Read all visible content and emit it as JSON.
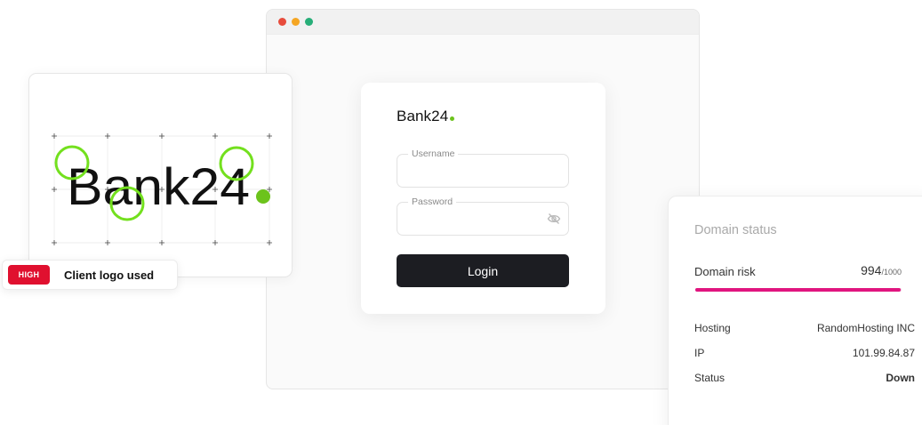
{
  "colors": {
    "dot_red": "#e74c3c",
    "dot_yellow": "#f5a623",
    "dot_green": "#27ae78",
    "brand_accent": "#6cc31c",
    "highlight_circle": "#73e01e",
    "severity_high": "#e0102f",
    "risk_bar": "#e0157f"
  },
  "browser": {
    "window_controls": [
      "close-dot",
      "minimize-dot",
      "maximize-dot"
    ]
  },
  "login": {
    "brand": "Bank24",
    "username_label": "Username",
    "username_value": "",
    "password_label": "Password",
    "password_value": "",
    "password_icon": "eye-off-icon",
    "login_button": "Login"
  },
  "logo_analysis": {
    "logo_text": "Bank24",
    "highlight_count": 3
  },
  "finding": {
    "severity": "HIGH",
    "label": "Client logo used"
  },
  "domain_status": {
    "title": "Domain status",
    "risk_label": "Domain risk",
    "risk_value": "994",
    "risk_max": "/1000",
    "risk_fraction": 0.994,
    "rows": [
      {
        "key": "Hosting",
        "value": "RandomHosting INC"
      },
      {
        "key": "IP",
        "value": "101.99.84.87"
      },
      {
        "key": "Status",
        "value": "Down"
      }
    ]
  }
}
